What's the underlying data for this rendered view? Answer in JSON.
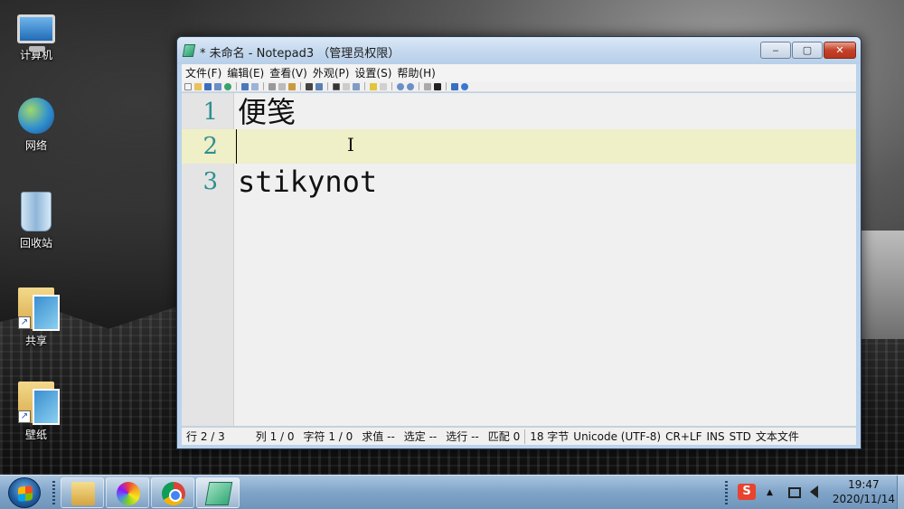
{
  "desktop": {
    "icons": [
      {
        "label": "计算机"
      },
      {
        "label": "网络"
      },
      {
        "label": "回收站"
      },
      {
        "label": "共享"
      },
      {
        "label": "壁纸"
      }
    ]
  },
  "window": {
    "title": "* 未命名 - Notepad3 （管理员权限）",
    "buttons": {
      "minimize": "‒",
      "maximize": "▢",
      "close": "✕"
    },
    "menu": [
      "文件(F)",
      "编辑(E)",
      "查看(V)",
      "外观(P)",
      "设置(S)",
      "帮助(H)"
    ]
  },
  "editor": {
    "lines": [
      {
        "number": "1",
        "text": "便笺"
      },
      {
        "number": "2",
        "text": ""
      },
      {
        "number": "3",
        "text": "stikynot"
      }
    ],
    "current_line": 2,
    "current_line_color": "#efefc8",
    "line_number_color": "#2f8f8f"
  },
  "statusbar": {
    "line": "行  2 / 3",
    "col": "列  1 / 0",
    "chars": "字符  1 / 0",
    "sum": "求值  --",
    "sel": "选定  --",
    "sellines": "选行  --",
    "match": "匹配  0",
    "size": "18 字节",
    "encoding": "Unicode (UTF-8)",
    "eol": "CR+LF",
    "ins": "INS",
    "std": "STD",
    "type": "文本文件"
  },
  "taskbar": {
    "tray_up_arrow": "▲",
    "time": "19:47",
    "date": "2020/11/14",
    "ime_label": "S"
  }
}
